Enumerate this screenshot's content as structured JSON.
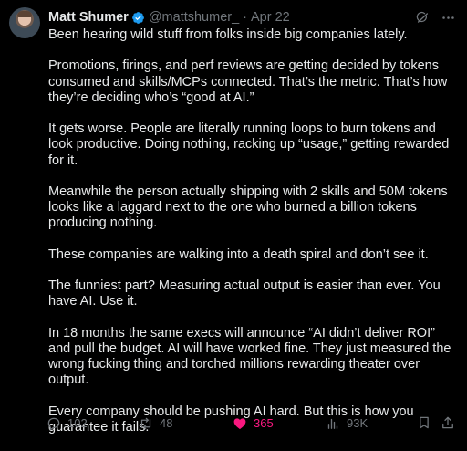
{
  "author": {
    "name": "Matt Shumer",
    "handle": "@mattshumer_",
    "separator": "·",
    "date": "Apr 22"
  },
  "body": {
    "paragraphs": [
      "Been hearing wild stuff from folks inside big companies lately.",
      "Promotions, firings, and perf reviews are getting decided by tokens consumed and skills/MCPs connected. That’s the metric. That’s how they’re deciding who’s “good at AI.”",
      "It gets worse. People are literally running loops to burn tokens and look productive. Doing nothing, racking up “usage,” getting rewarded for it.",
      "Meanwhile the person actually shipping with 2 skills and 50M tokens looks like a laggard next to the one who burned a billion tokens producing nothing.",
      "These companies are walking into a death spiral and don’t see it.",
      "The funniest part? Measuring actual output is easier than ever. You have AI. Use it.",
      "In 18 months the same execs will announce “AI didn’t deliver ROI” and pull the budget. AI will have worked fine. They just measured the wrong fucking thing and torched millions rewarding theater over output.",
      "Every company should be pushing AI hard. But this is how you guarantee it fails."
    ]
  },
  "actions": {
    "replies": "102",
    "reposts": "48",
    "likes": "365",
    "views": "93K"
  },
  "icons": {
    "verified": "verified-badge-icon",
    "grok": "grok-icon",
    "more": "more-icon",
    "reply": "reply-icon",
    "repost": "repost-icon",
    "like": "heart-icon",
    "views": "views-icon",
    "bookmark": "bookmark-icon",
    "share": "share-icon"
  },
  "colors": {
    "background": "#000000",
    "text": "#e7e9ea",
    "secondary": "#71767b",
    "verified": "#1d9bf0",
    "like": "#f91880"
  }
}
